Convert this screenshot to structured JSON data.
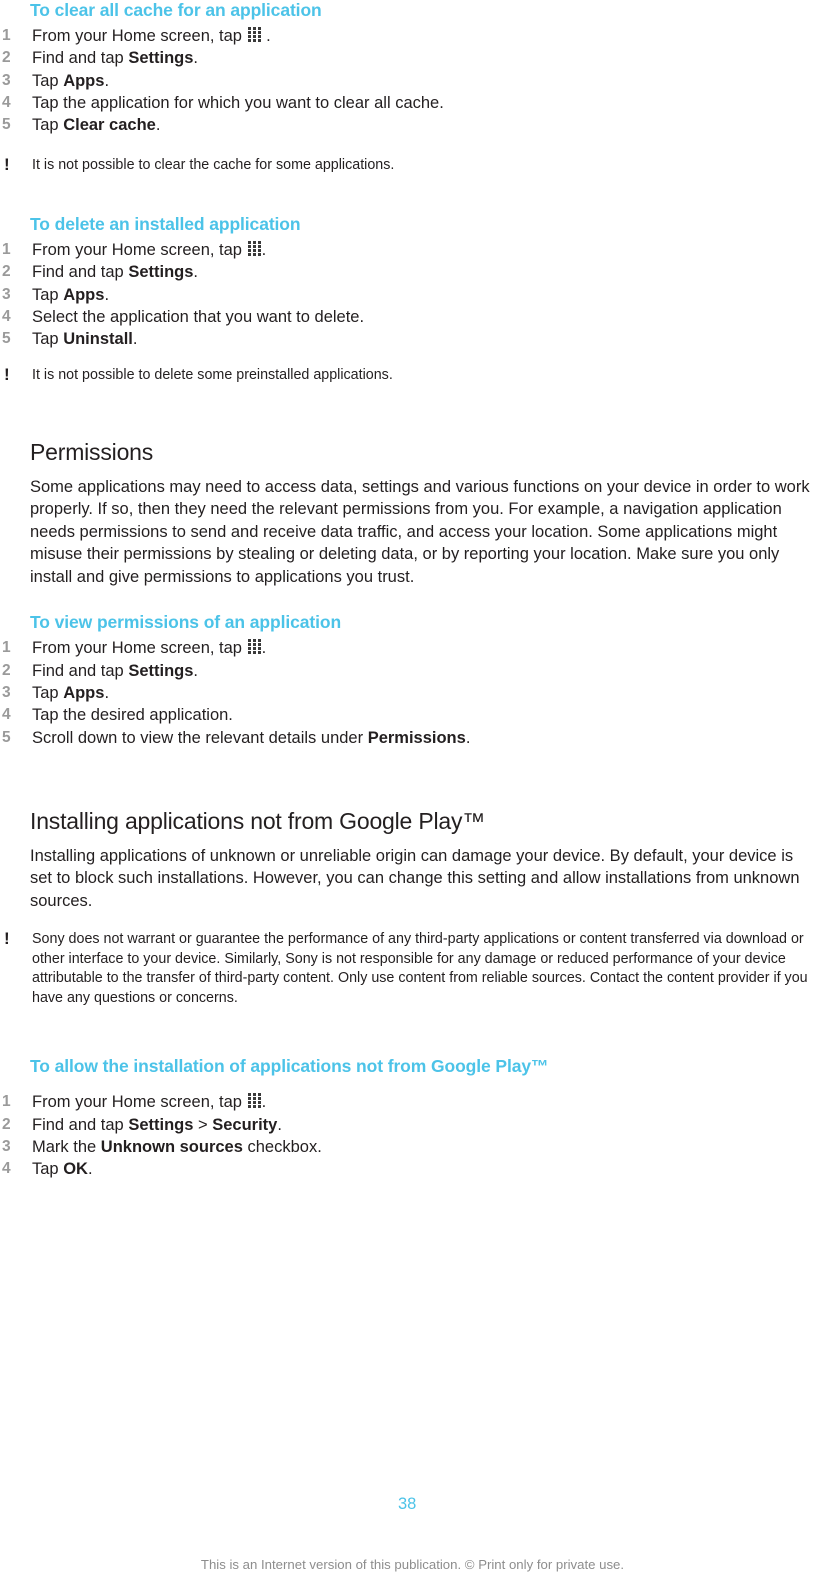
{
  "page": {
    "number": "38",
    "footer_note": "This is an Internet version of this publication. © Print only for private use.",
    "accent_color": "#4cc3e8",
    "text_color": "#231f20",
    "step_number_color": "#9a9a9a",
    "footer_color": "#8d8d8d"
  },
  "icons": {
    "app_drawer": "grid-icon",
    "note": "!"
  },
  "sections": [
    {
      "id": "clear-cache",
      "type": "procedure",
      "heading": "To clear all cache for an application",
      "steps": [
        {
          "num": "1",
          "pre": "From your Home screen, tap ",
          "icon": "grid-icon",
          "post": " ."
        },
        {
          "num": "2",
          "pre": "Find and tap ",
          "bold": "Settings",
          "post": "."
        },
        {
          "num": "3",
          "pre": "Tap ",
          "bold": "Apps",
          "post": "."
        },
        {
          "num": "4",
          "pre": "Tap the application for which you want to clear all cache.",
          "post": ""
        },
        {
          "num": "5",
          "pre": "Tap ",
          "bold": "Clear cache",
          "post": "."
        }
      ],
      "note": "It is not possible to clear the cache for some applications."
    },
    {
      "id": "delete-application",
      "type": "procedure",
      "heading": "To delete an installed application",
      "steps": [
        {
          "num": "1",
          "pre": "From your Home screen, tap ",
          "icon": "grid-icon",
          "post": "."
        },
        {
          "num": "2",
          "pre": "Find and tap ",
          "bold": "Settings",
          "post": "."
        },
        {
          "num": "3",
          "pre": "Tap ",
          "bold": "Apps",
          "post": "."
        },
        {
          "num": "4",
          "pre": "Select the application that you want to delete.",
          "post": ""
        },
        {
          "num": "5",
          "pre": "Tap ",
          "bold": "Uninstall",
          "post": "."
        }
      ],
      "note": "It is not possible to delete some preinstalled applications."
    },
    {
      "id": "permissions",
      "type": "section",
      "heading": "Permissions",
      "paragraph": "Some applications may need to access data, settings and various functions on your device in order to work properly. If so, then they need the relevant permissions from you. For example, a navigation application needs permissions to send and receive data traffic, and access your location. Some applications might misuse their permissions by stealing or deleting data, or by reporting your location. Make sure you only install and give permissions to applications you trust."
    },
    {
      "id": "view-permissions",
      "type": "procedure",
      "heading": "To view permissions of an application",
      "steps": [
        {
          "num": "1",
          "pre": "From your Home screen, tap ",
          "icon": "grid-icon",
          "post": "."
        },
        {
          "num": "2",
          "pre": "Find and tap ",
          "bold": "Settings",
          "post": "."
        },
        {
          "num": "3",
          "pre": "Tap ",
          "bold": "Apps",
          "post": "."
        },
        {
          "num": "4",
          "pre": "Tap the desired application.",
          "post": ""
        },
        {
          "num": "5",
          "pre": "Scroll down to view the relevant details under ",
          "bold": "Permissions",
          "post": "."
        }
      ]
    },
    {
      "id": "installing-not-google-play",
      "type": "section",
      "heading": "Installing applications not from Google Play™",
      "paragraph": "Installing applications of unknown or unreliable origin can damage your device. By default, your device is set to block such installations. However, you can change this setting and allow installations from unknown sources.",
      "note": "Sony does not warrant or guarantee the performance of any third-party applications or content transferred via download or other interface to your device. Similarly, Sony is not responsible for any damage or reduced performance of your device attributable to the transfer of third-party content. Only use content from reliable sources. Contact the content provider if you have any questions or concerns."
    },
    {
      "id": "allow-installation",
      "type": "procedure",
      "heading": "To allow the installation of applications not from Google Play™",
      "steps": [
        {
          "num": "1",
          "pre": "From your Home screen, tap ",
          "icon": "grid-icon",
          "post": "."
        },
        {
          "num": "2",
          "pre": "Find and tap ",
          "bold": "Settings",
          "mid": " > ",
          "bold2": "Security",
          "post": "."
        },
        {
          "num": "3",
          "pre": "Mark the ",
          "bold": "Unknown sources",
          "post": " checkbox."
        },
        {
          "num": "4",
          "pre": "Tap ",
          "bold": "OK",
          "post": "."
        }
      ]
    }
  ]
}
